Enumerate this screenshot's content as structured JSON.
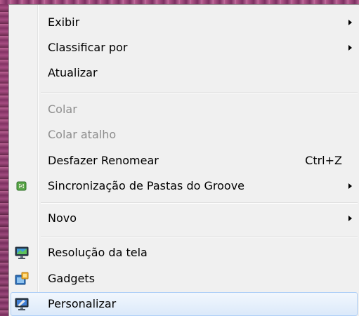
{
  "context_menu": {
    "items": [
      {
        "label": "Exibir",
        "submenu": true
      },
      {
        "label": "Classificar por",
        "submenu": true
      },
      {
        "label": "Atualizar"
      },
      {
        "label": "Colar",
        "disabled": true
      },
      {
        "label": "Colar atalho",
        "disabled": true
      },
      {
        "label": "Desfazer Renomear",
        "shortcut": "Ctrl+Z"
      },
      {
        "label": "Sincronização de Pastas do Groove",
        "submenu": true,
        "icon": "groove-sync-icon"
      },
      {
        "label": "Novo",
        "submenu": true
      },
      {
        "label": "Resolução da tela",
        "icon": "screen-resolution-icon"
      },
      {
        "label": "Gadgets",
        "icon": "gadgets-icon"
      },
      {
        "label": "Personalizar",
        "icon": "personalize-icon",
        "highlighted": true
      }
    ]
  },
  "colors": {
    "menu_background": "#f0f0f0",
    "disabled_text": "#8d8d8d",
    "hover_border": "#aecff7"
  }
}
